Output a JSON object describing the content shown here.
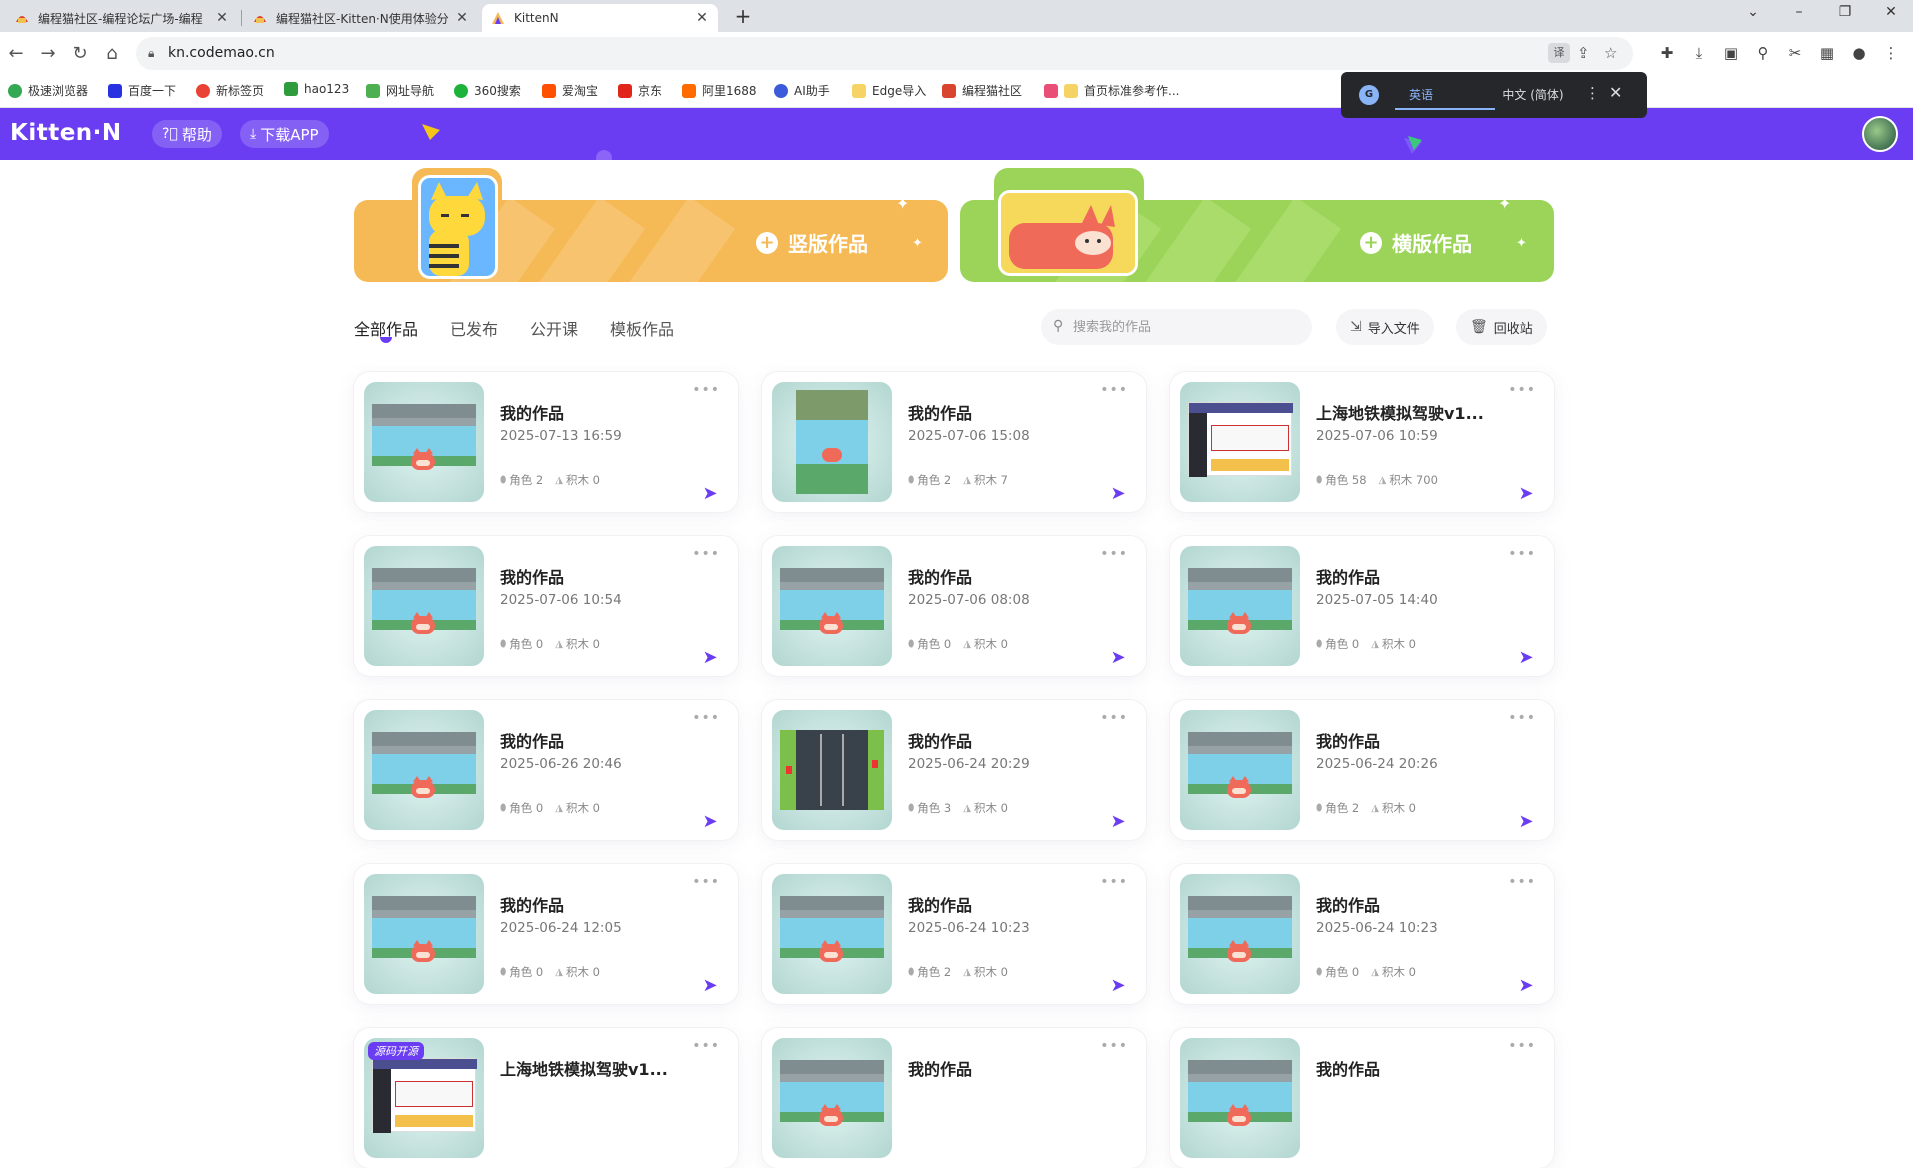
{
  "browser": {
    "tabs": [
      {
        "title": "编程猫社区-编程论坛广场-编程"
      },
      {
        "title": "编程猫社区-Kitten·N使用体验分"
      },
      {
        "title": "KittenN"
      }
    ],
    "url": "kn.codemao.cn",
    "bookmarks": [
      "极速浏览器",
      "百度一下",
      "新标签页",
      "hao123",
      "网址导航",
      "360搜索",
      "爱淘宝",
      "京东",
      "阿里1688",
      "AI助手",
      "Edge导入",
      "编程猫社区",
      "首页标准参考作..."
    ],
    "translate": {
      "lang_source": "英语",
      "lang_target": "中文 (简体)"
    }
  },
  "header": {
    "logo": "Kitten·N",
    "help_label": "帮助",
    "download_label": "下载APP"
  },
  "banners": {
    "vertical_label": "竖版作品",
    "horizontal_label": "横版作品"
  },
  "filters": {
    "tabs": [
      "全部作品",
      "已发布",
      "公开课",
      "模板作品"
    ],
    "active": "全部作品"
  },
  "search": {
    "placeholder": "搜索我的作品"
  },
  "actions": {
    "import_label": "导入文件",
    "recycle_label": "回收站"
  },
  "works": [
    {
      "title": "我的作品",
      "date": "2025-07-13 16:59",
      "roles": "角色 2",
      "blocks": "积木 0",
      "thumb": "lake"
    },
    {
      "title": "我的作品",
      "date": "2025-07-06 15:08",
      "roles": "角色 2",
      "blocks": "积木 7",
      "thumb": "lake-vertical"
    },
    {
      "title": "上海地铁模拟驾驶v1...",
      "date": "2025-07-06 10:59",
      "roles": "角色 58",
      "blocks": "积木 700",
      "thumb": "metro"
    },
    {
      "title": "我的作品",
      "date": "2025-07-06 10:54",
      "roles": "角色 0",
      "blocks": "积木 0",
      "thumb": "lake"
    },
    {
      "title": "我的作品",
      "date": "2025-07-06 08:08",
      "roles": "角色 0",
      "blocks": "积木 0",
      "thumb": "lake"
    },
    {
      "title": "我的作品",
      "date": "2025-07-05 14:40",
      "roles": "角色 0",
      "blocks": "积木 0",
      "thumb": "lake"
    },
    {
      "title": "我的作品",
      "date": "2025-06-26 20:46",
      "roles": "角色 0",
      "blocks": "积木 0",
      "thumb": "lake"
    },
    {
      "title": "我的作品",
      "date": "2025-06-24 20:29",
      "roles": "角色 3",
      "blocks": "积木 0",
      "thumb": "road"
    },
    {
      "title": "我的作品",
      "date": "2025-06-24 20:26",
      "roles": "角色 2",
      "blocks": "积木 0",
      "thumb": "lake"
    },
    {
      "title": "我的作品",
      "date": "2025-06-24 12:05",
      "roles": "角色 0",
      "blocks": "积木 0",
      "thumb": "lake"
    },
    {
      "title": "我的作品",
      "date": "2025-06-24 10:23",
      "roles": "角色 2",
      "blocks": "积木 0",
      "thumb": "lake"
    },
    {
      "title": "我的作品",
      "date": "2025-06-24 10:23",
      "roles": "角色 0",
      "blocks": "积木 0",
      "thumb": "lake"
    },
    {
      "title": "上海地铁模拟驾驶v1...",
      "badge": "源码开源",
      "thumb": "metro-dark"
    },
    {
      "title": "我的作品",
      "thumb": "lake"
    },
    {
      "title": "我的作品",
      "thumb": "lake"
    }
  ],
  "colors": {
    "brand": "#6a3df3",
    "vertical_banner": "#f5b956",
    "horizontal_banner": "#9bd458"
  }
}
